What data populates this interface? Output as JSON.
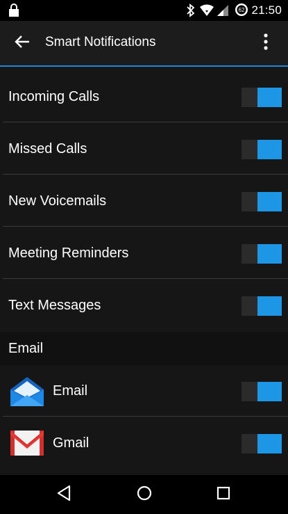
{
  "status_bar": {
    "time": "21:50",
    "battery_level": "62",
    "icons": [
      "lock-icon",
      "bluetooth-icon",
      "wifi-icon",
      "signal-icon",
      "battery-icon"
    ]
  },
  "app_bar": {
    "title": "Smart Notifications",
    "back_icon": "arrow-left-icon",
    "menu_icon": "more-vert-icon"
  },
  "settings": [
    {
      "label": "Incoming Calls",
      "enabled": true
    },
    {
      "label": "Missed Calls",
      "enabled": true
    },
    {
      "label": "New Voicemails",
      "enabled": true
    },
    {
      "label": "Meeting Reminders",
      "enabled": true
    },
    {
      "label": "Text Messages",
      "enabled": true
    }
  ],
  "email_section": {
    "header": "Email",
    "apps": [
      {
        "label": "Email",
        "icon": "email-app-icon",
        "enabled": true
      },
      {
        "label": "Gmail",
        "icon": "gmail-app-icon",
        "enabled": true
      }
    ]
  },
  "nav_bar": {
    "buttons": [
      "back-nav-icon",
      "home-nav-icon",
      "recents-nav-icon"
    ]
  },
  "colors": {
    "accent": "#1e96e6",
    "appbar": "#1c1c1c",
    "background": "#161616",
    "section_header": "#111111",
    "toggle_track": "#2b2b2b"
  }
}
